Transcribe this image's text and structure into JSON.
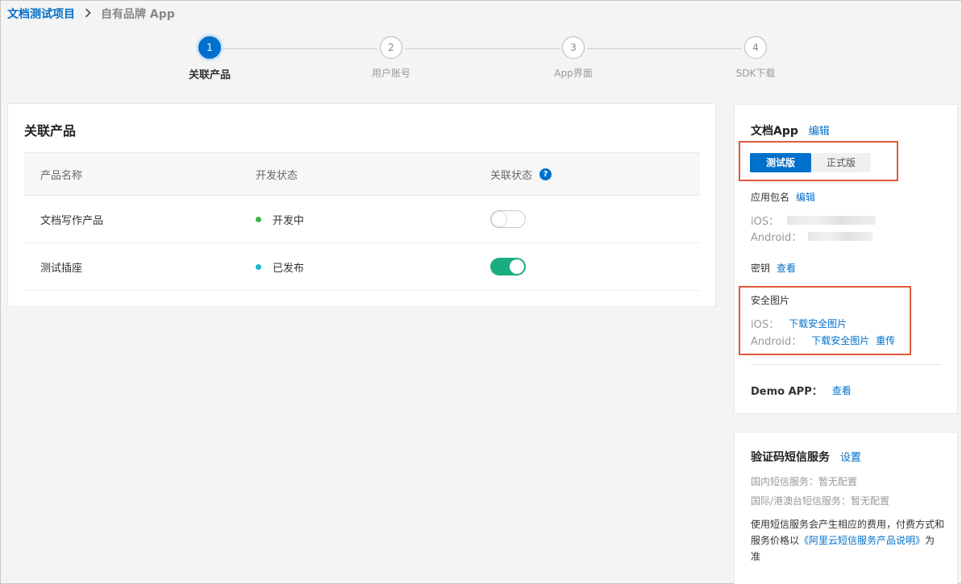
{
  "breadcrumb": {
    "root": "文档测试项目",
    "separator": ">",
    "current": "自有品牌 App"
  },
  "steps": [
    {
      "number": "1",
      "label": "关联产品",
      "active": true
    },
    {
      "number": "2",
      "label": "用户账号",
      "active": false
    },
    {
      "number": "3",
      "label": "App界面",
      "active": false
    },
    {
      "number": "4",
      "label": "SDK下载",
      "active": false
    }
  ],
  "products_panel": {
    "title": "关联产品",
    "columns": [
      "产品名称",
      "开发状态",
      "关联状态"
    ],
    "help_icon": "?",
    "rows": [
      {
        "name": "文档写作产品",
        "status": "开发中",
        "status_color": "#3bb54a",
        "linked": false
      },
      {
        "name": "测试插座",
        "status": "已发布",
        "status_color": "#17b8d4",
        "linked": true
      }
    ]
  },
  "app_panel": {
    "title": "文档App",
    "edit_label": "编辑",
    "tabs": [
      "测试版",
      "正式版"
    ],
    "package": {
      "label": "应用包名",
      "edit_label": "编辑",
      "ios_label": "iOS：",
      "android_label": "Android："
    },
    "secret": {
      "label": "密钥",
      "view_label": "查看"
    },
    "security_image": {
      "label": "安全图片",
      "ios_label": "iOS：",
      "android_label": "Android：",
      "download_label": "下载安全图片",
      "reupload_label": "重传"
    },
    "demo": {
      "label": "Demo APP：",
      "view_label": "查看"
    }
  },
  "sms_panel": {
    "title": "验证码短信服务",
    "settings_label": "设置",
    "domestic": "国内短信服务：暂无配置",
    "international": "国际/港澳台短信服务：暂无配置",
    "note_prefix": "使用短信服务会产生相应的费用，付费方式和服务价格以",
    "note_link": "《阿里云短信服务产品说明》",
    "note_suffix": "为准"
  },
  "colors": {
    "accent": "#0070cc",
    "switch_on": "#1aad80",
    "highlight_box": "#e05a3a"
  }
}
